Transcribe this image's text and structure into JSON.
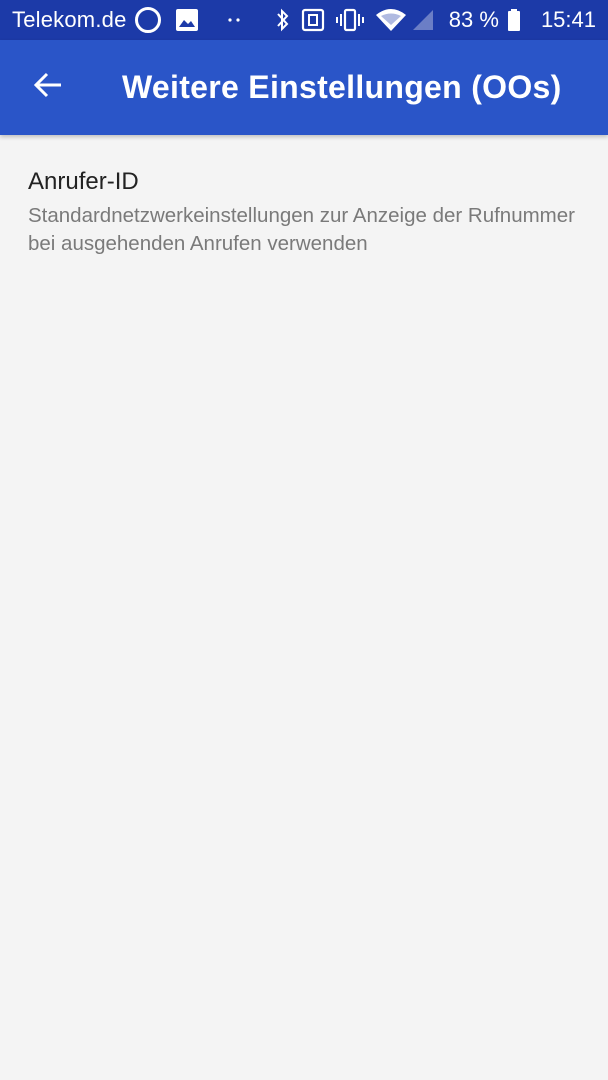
{
  "status_bar": {
    "carrier": "Telekom.de",
    "battery": "83 %",
    "time": "15:41",
    "icons": [
      "alexa-ring-icon",
      "image-icon",
      "dots-icon",
      "bluetooth-icon",
      "nfc-icon",
      "vibrate-icon",
      "wifi-icon",
      "signal-icon",
      "battery-icon"
    ]
  },
  "app_bar": {
    "back_icon": "arrow-left-icon",
    "title": "Weitere Einstellungen (OOs)"
  },
  "preferences": [
    {
      "title": "Anrufer-ID",
      "summary": "Standardnetzwerkeinstellungen zur Anzeige der Rufnummer bei ausgehenden Anrufen verwenden"
    }
  ],
  "colors": {
    "status_bar": "#1c3aa8",
    "app_bar": "#2a55c8",
    "background": "#f4f4f4",
    "title_text": "#222222",
    "summary_text": "#7a7a7a"
  }
}
